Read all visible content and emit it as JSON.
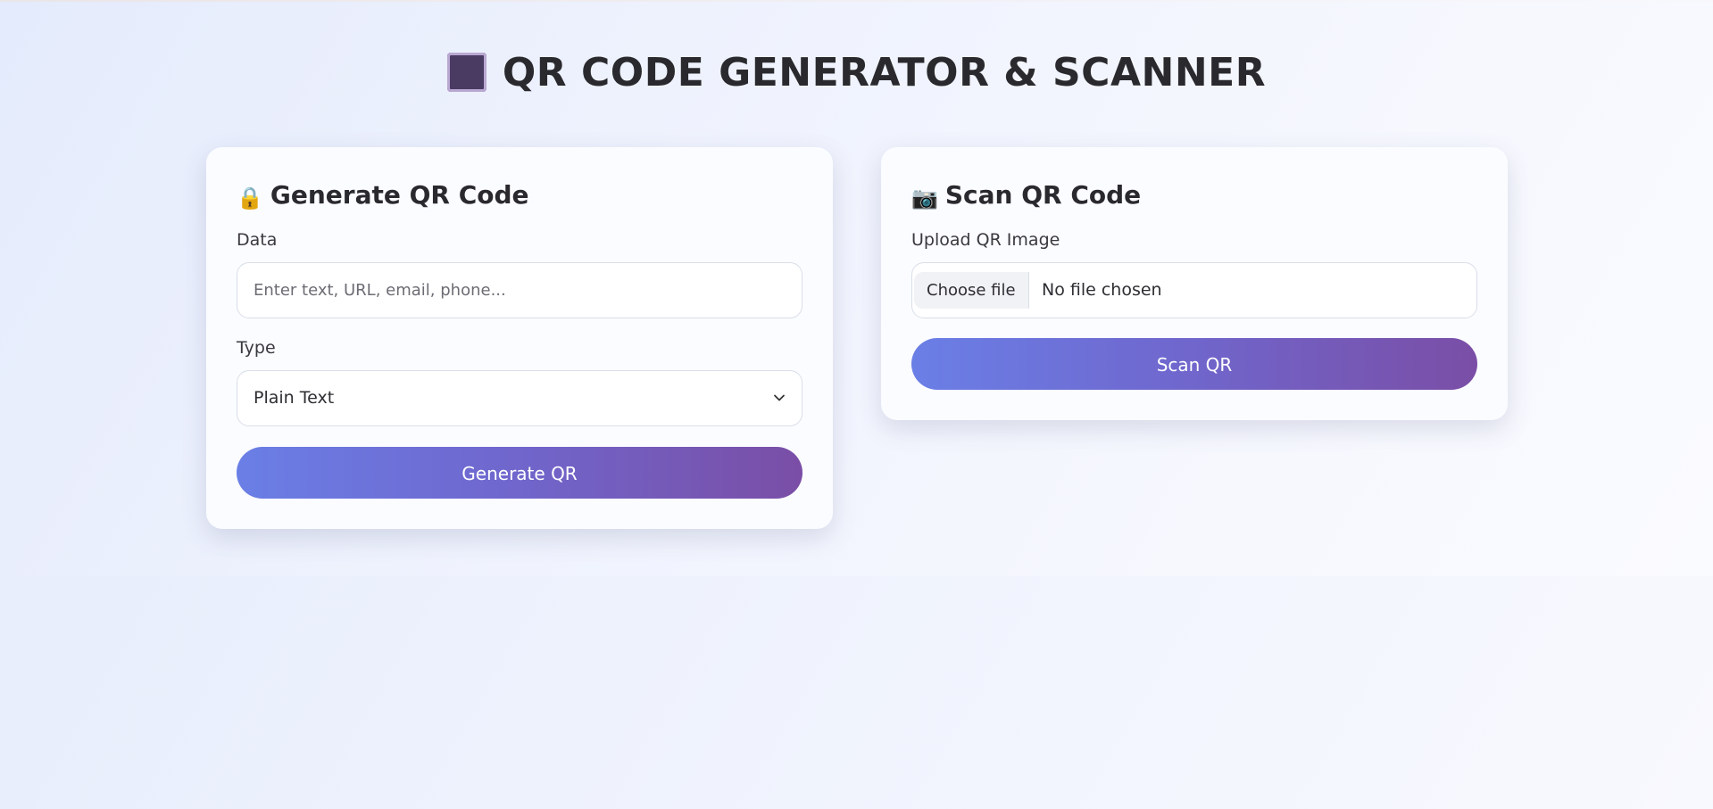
{
  "page": {
    "title": "QR CODE GENERATOR & SCANNER",
    "title_icon": "qr-square-icon"
  },
  "generate": {
    "heading": "Generate QR Code",
    "heading_icon": "lock-icon",
    "data_label": "Data",
    "data_value": "",
    "data_placeholder": "Enter text, URL, email, phone...",
    "type_label": "Type",
    "type_selected": "Plain Text",
    "button_label": "Generate QR"
  },
  "scan": {
    "heading": "Scan QR Code",
    "heading_icon": "camera-icon",
    "upload_label": "Upload QR Image",
    "choose_file_label": "Choose file",
    "file_status": "No file chosen",
    "button_label": "Scan QR"
  },
  "colors": {
    "button_gradient_start": "#6a7fe6",
    "button_gradient_end": "#7a4ea6",
    "card_background": "#fbfcff",
    "title_color": "#2a2a2e"
  }
}
